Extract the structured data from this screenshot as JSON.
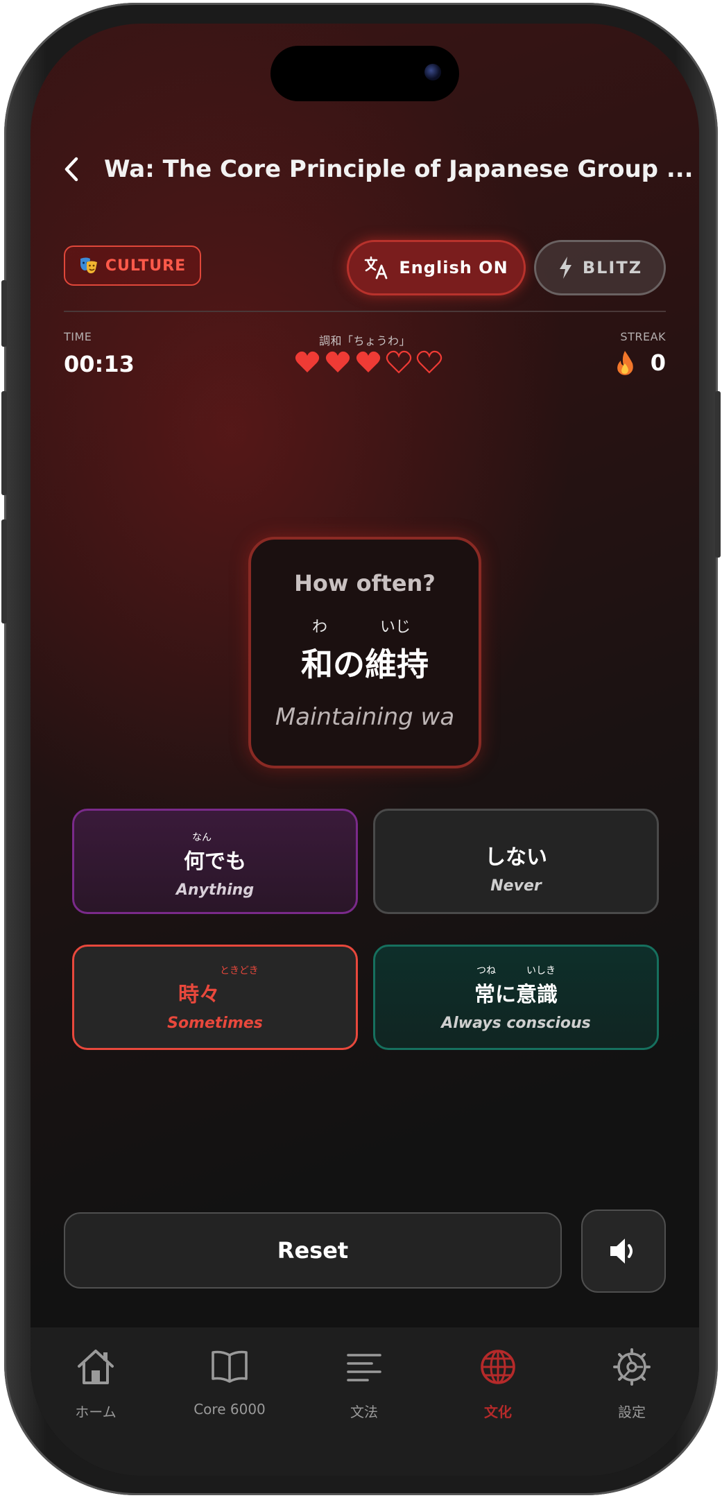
{
  "header": {
    "title": "Wa: The Core Principle of Japanese Group ..."
  },
  "controls": {
    "category_tag": "CULTURE",
    "english_toggle": "English ON",
    "blitz_toggle": "BLITZ"
  },
  "stats": {
    "time_label": "TIME",
    "time_value": "00:13",
    "topic_label": "調和「ちょうわ」",
    "hearts_filled": 3,
    "hearts_total": 5,
    "streak_label": "STREAK",
    "streak_value": "0"
  },
  "question": {
    "prompt": "How often?",
    "furigana_1": "わ",
    "furigana_2": "いじ",
    "japanese": "和の維持",
    "english": "Maintaining wa"
  },
  "options": [
    {
      "furigana": "なん",
      "japanese": "何でも",
      "english": "Anything"
    },
    {
      "furigana": "",
      "japanese": "しない",
      "english": "Never"
    },
    {
      "furigana": "ときどき",
      "japanese": "時々",
      "english": "Sometimes"
    },
    {
      "furigana_a": "つね",
      "furigana_b": "いしき",
      "japanese": "常に意識",
      "english": "Always conscious"
    }
  ],
  "actions": {
    "reset_label": "Reset"
  },
  "tabs": [
    {
      "label": "ホーム",
      "icon": "home-icon"
    },
    {
      "label": "Core 6000",
      "icon": "book-icon"
    },
    {
      "label": "文法",
      "icon": "lines-icon"
    },
    {
      "label": "文化",
      "icon": "globe-icon",
      "active": true
    },
    {
      "label": "設定",
      "icon": "gear-icon"
    }
  ],
  "colors": {
    "accent_red": "#e8483c",
    "active_tab": "#b52a2a",
    "heart": "#ef3b35"
  }
}
